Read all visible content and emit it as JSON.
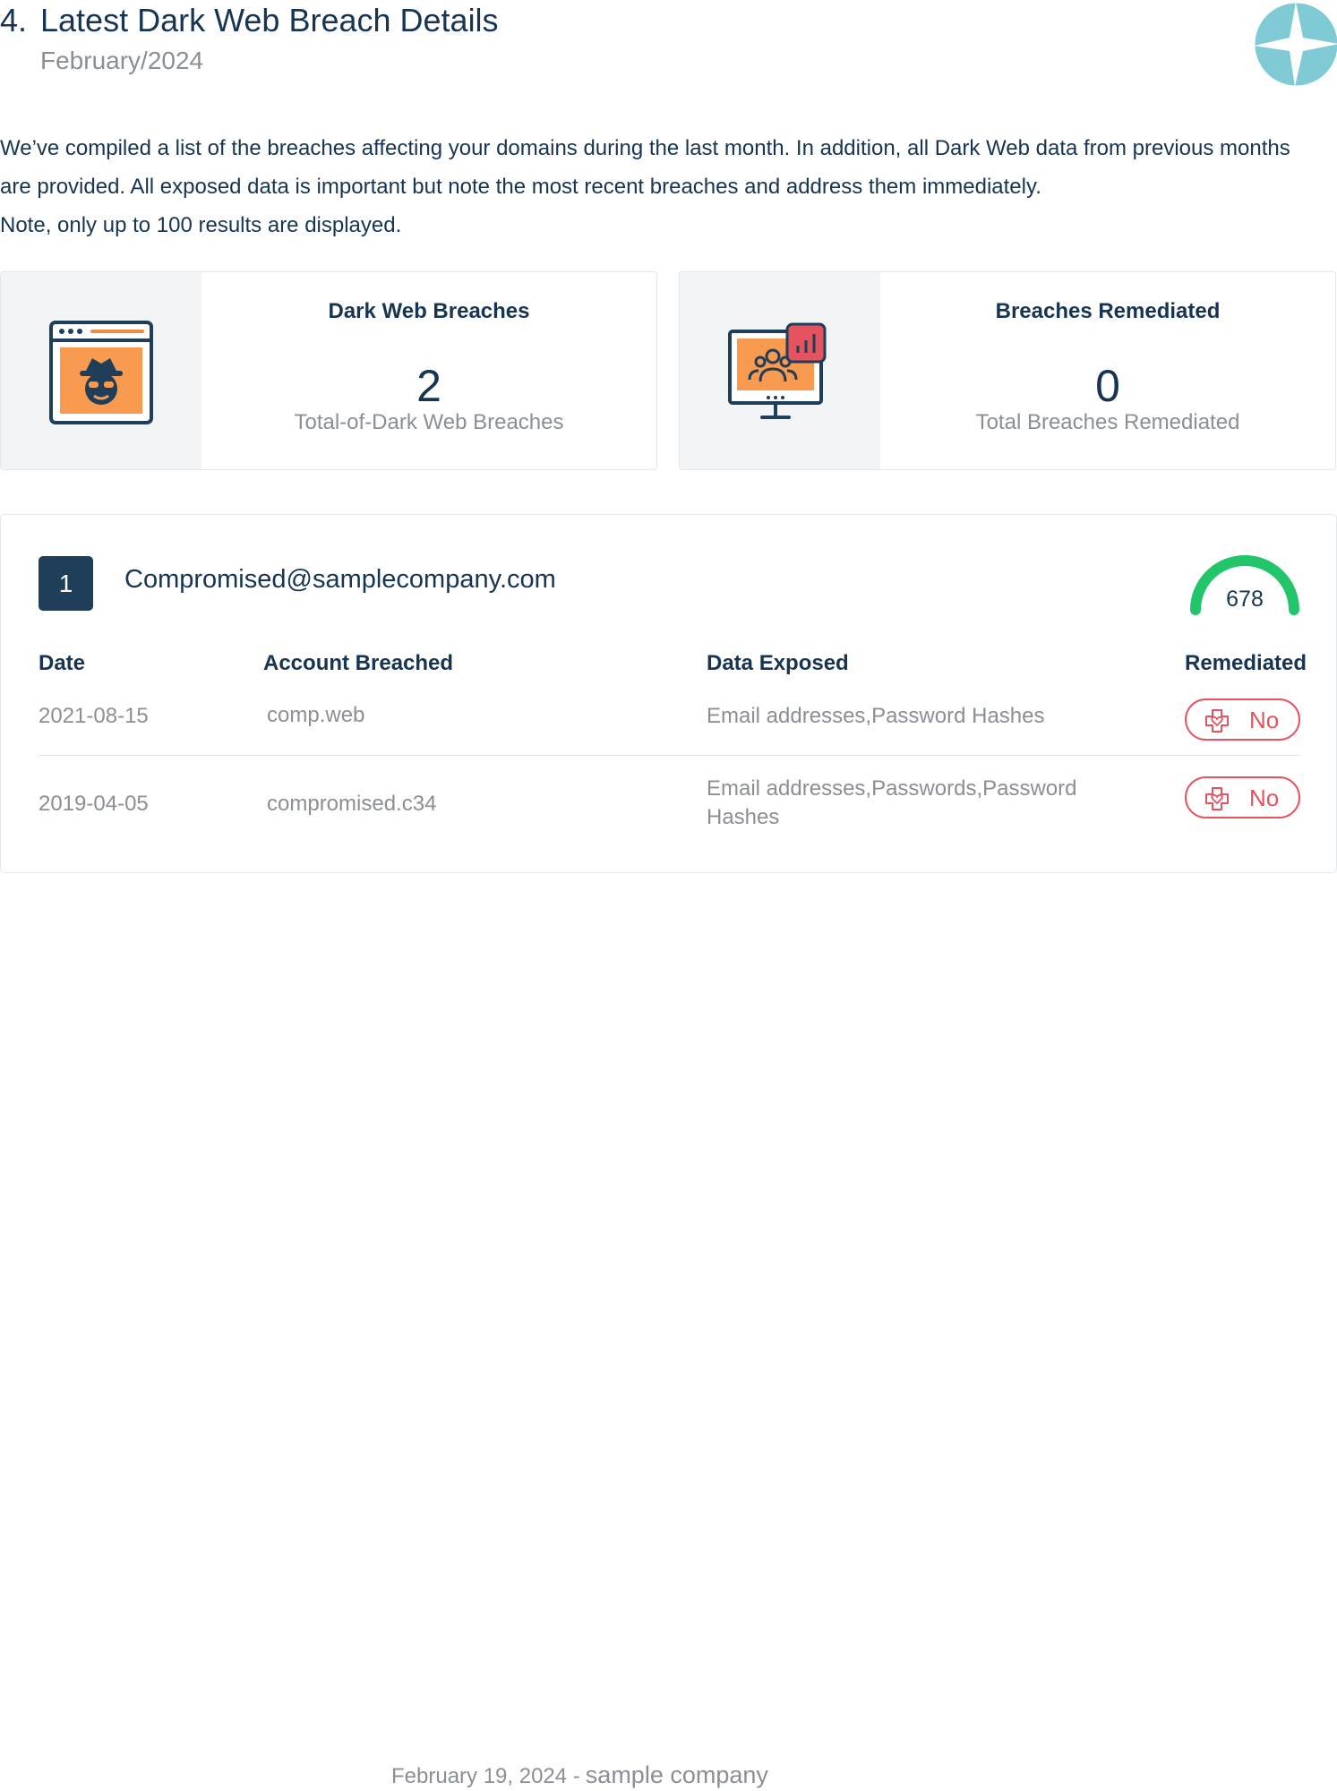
{
  "header": {
    "number": "4.",
    "title": "Latest Dark Web Breach Details",
    "period": "February/2024"
  },
  "intro": {
    "line1": "We’ve compiled a list of the breaches affecting your domains during the last month. In addition, all Dark Web data from previous months",
    "line2": "are provided. All exposed data is important but note the most recent breaches and address them immediately.",
    "line3": "Note, only up to 100 results are displayed."
  },
  "stats": {
    "breaches": {
      "title": "Dark Web Breaches",
      "value": "2",
      "subtitle": "Total-of-Dark Web Breaches"
    },
    "remediated": {
      "title": "Breaches Remediated",
      "value": "0",
      "subtitle": "Total Breaches Remediated"
    }
  },
  "breach": {
    "index": "1",
    "email": "Compromised@samplecompany.com",
    "score": "678",
    "columns": {
      "date": "Date",
      "account": "Account Breached",
      "data": "Data Exposed",
      "remediated": "Remediated"
    },
    "rows": [
      {
        "date": "2021-08-15",
        "account": "comp.web",
        "data": "Email addresses,Password Hashes",
        "data2": "",
        "remediated": "No"
      },
      {
        "date": "2019-04-05",
        "account": "compromised.c34",
        "data": "Email addresses,Passwords,Password",
        "data2": "Hashes",
        "remediated": "No"
      }
    ]
  },
  "footer": {
    "date": "February 19, 2024 -",
    "company": "sample company"
  },
  "colors": {
    "navy": "#1e3e5a",
    "orange": "#f89a4f",
    "red": "#e5535e",
    "green": "#22c56a",
    "teal": "#7fcad4"
  }
}
